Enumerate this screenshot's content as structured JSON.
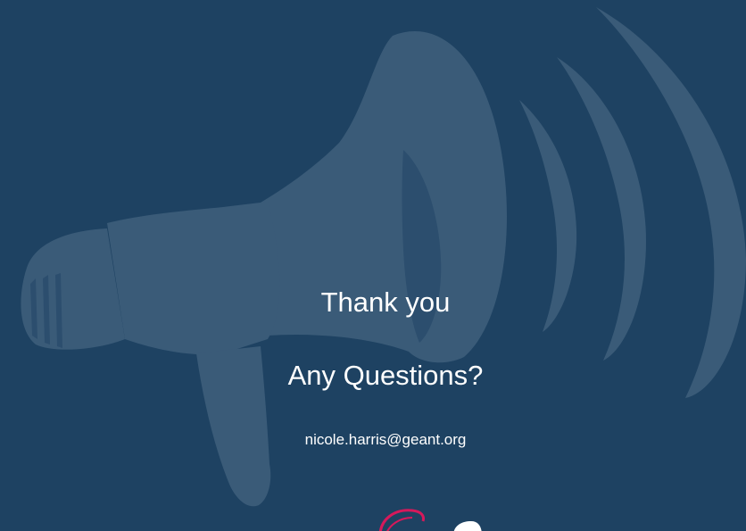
{
  "slide": {
    "title": "Thank you",
    "subtitle": "Any Questions?",
    "email": "nicole.harris@geant.org"
  },
  "colors": {
    "background": "#1e4262",
    "megaphone": "#3a5b78",
    "text": "#ffffff",
    "logo_accent": "#d6195b"
  },
  "icons": {
    "background_graphic": "megaphone-icon",
    "footer_logo": "geant-logo"
  }
}
